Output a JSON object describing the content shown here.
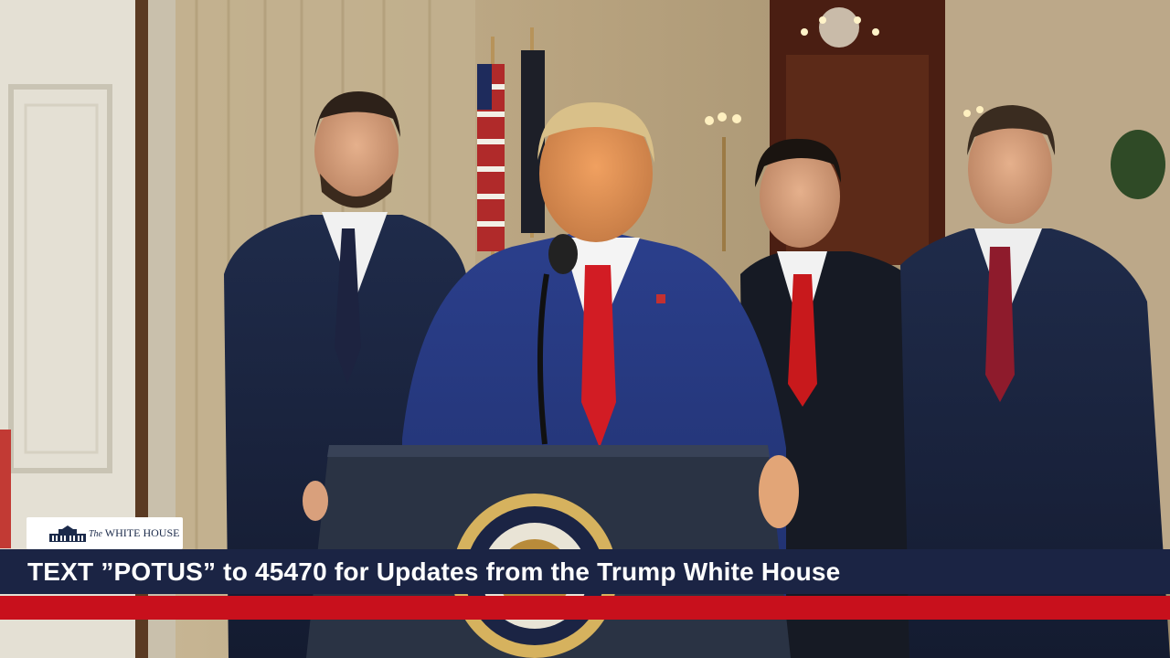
{
  "logo": {
    "icon": "white-house-icon",
    "prefix": "The",
    "name": "WHITE HOUSE"
  },
  "chyron": {
    "text": "TEXT ”POTUS” to 45470 for Updates from the Trump White House"
  },
  "colors": {
    "chyron_bar": "#1b2444",
    "chyron_accent": "#c8101c",
    "logo_bg": "#ffffff"
  }
}
